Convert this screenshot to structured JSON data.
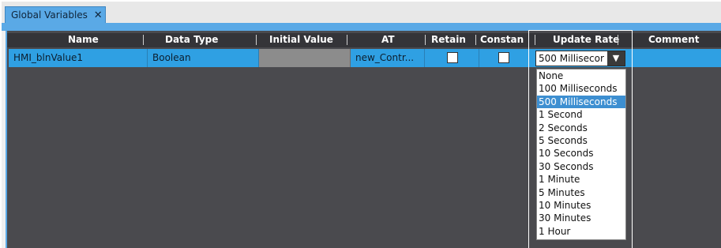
{
  "tab": {
    "title": "Global Variables",
    "close": "✕"
  },
  "columns": {
    "name": "Name",
    "data_type": "Data Type",
    "initial_value": "Initial Value",
    "at": "AT",
    "retain": "Retain",
    "constant": "Constan",
    "update_rate": "Update Rate",
    "comment": "Comment"
  },
  "row": {
    "name": "HMI_blnValue1",
    "data_type": "Boolean",
    "initial_value": "",
    "at": "new_Contr...",
    "retain": false,
    "constant": false,
    "update_rate": "500 Millisecor"
  },
  "dropdown": {
    "arrow": "▼",
    "options": [
      "None",
      "100 Milliseconds",
      "500 Milliseconds",
      "1 Second",
      "2 Seconds",
      "5 Seconds",
      "10 Seconds",
      "30 Seconds",
      "1 Minute",
      "5 Minutes",
      "10 Minutes",
      "30 Minutes",
      "1 Hour"
    ],
    "selected": "500 Milliseconds"
  }
}
